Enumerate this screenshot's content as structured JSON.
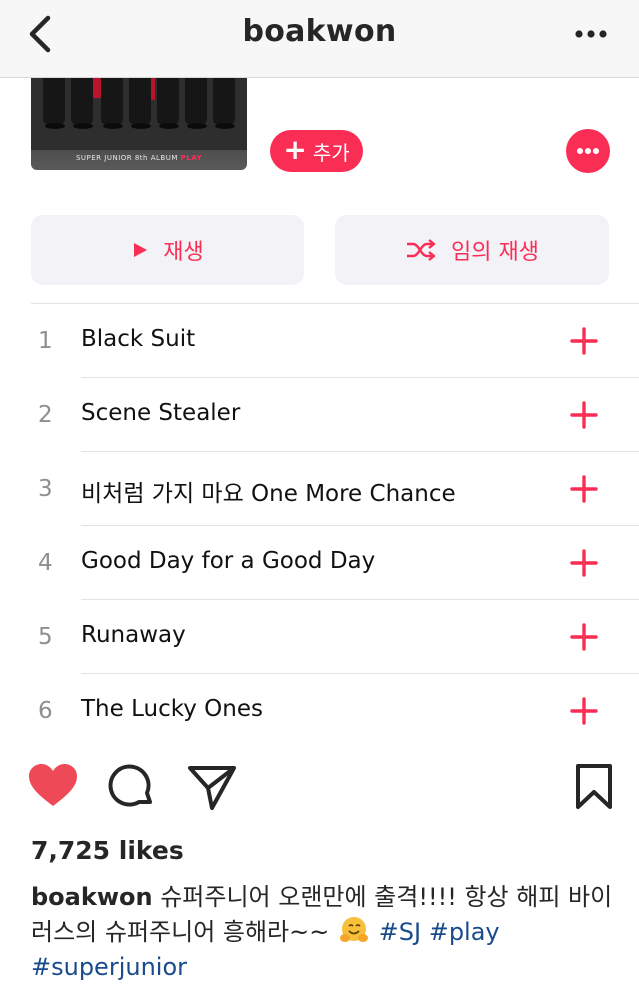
{
  "header": {
    "title": "boakwon",
    "back_icon": "chevron-left-icon",
    "more_icon": "ellipsis-icon"
  },
  "album": {
    "cover_caption": "SUPER JUNIOR 8th ALBUM",
    "cover_caption_accent": "PLAY",
    "add_label": "추가",
    "more_icon": "ellipsis-icon"
  },
  "controls": {
    "play_label": "재생",
    "shuffle_label": "임의 재생"
  },
  "tracks": [
    {
      "num": "1",
      "name": "Black Suit"
    },
    {
      "num": "2",
      "name": "Scene Stealer"
    },
    {
      "num": "3",
      "name": "비처럼 가지 마요 One More Chance"
    },
    {
      "num": "4",
      "name": "Good Day for a Good Day"
    },
    {
      "num": "5",
      "name": "Runaway"
    },
    {
      "num": "6",
      "name": "The Lucky Ones"
    }
  ],
  "post": {
    "likes": "7,725 likes",
    "username": "boakwon",
    "caption_text": " 슈퍼주니어 오랜만에 출격!!!! 항상 해피 바이러스의 슈퍼주니어 흥해라~~ ",
    "hashtags": [
      "#SJ",
      "#play",
      "#superjunior"
    ],
    "emoji": "hugging-face-emoji"
  },
  "colors": {
    "accent": "#fa2d55",
    "like_red": "#ed4956",
    "hashtag": "#1a4b8c"
  }
}
